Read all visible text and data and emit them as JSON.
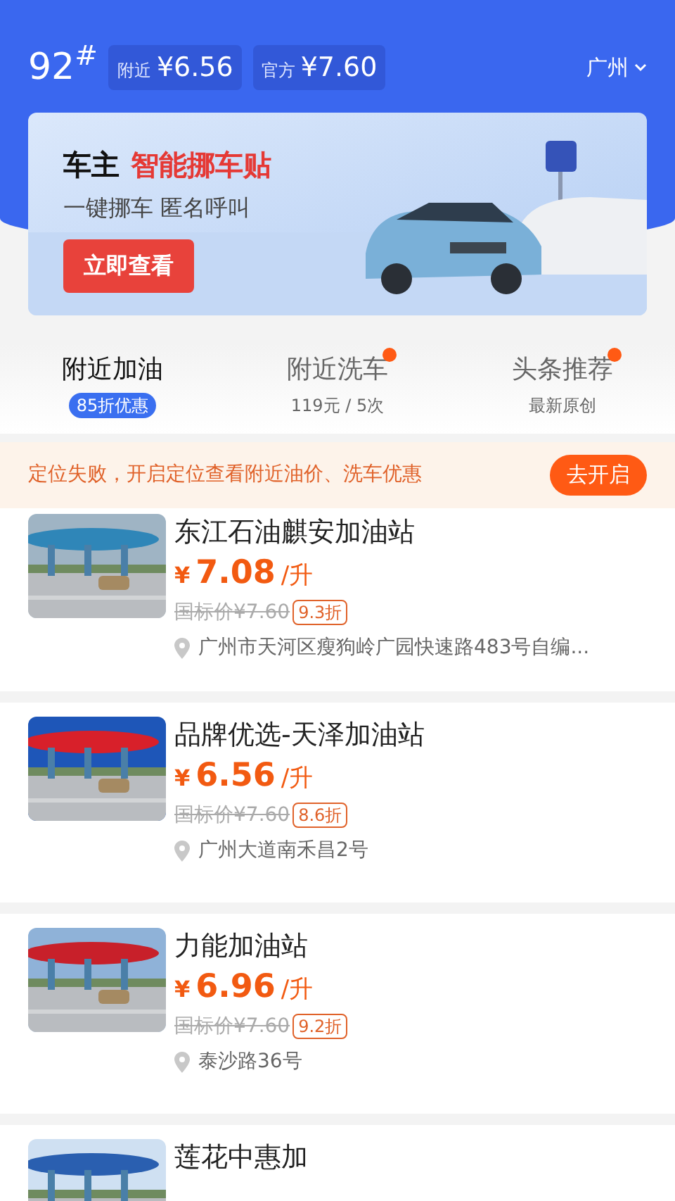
{
  "header": {
    "fuel": "92$^{#}$",
    "prices": [
      {
        "label": "附近",
        "value": "¥6.56"
      },
      {
        "label": "官方",
        "value": "¥7.60"
      }
    ],
    "city": "广州"
  },
  "banner": {
    "title": "车主",
    "highlight": "智能挪车贴",
    "subtitle": "一键挪车 匿名呼叫",
    "button": "立即查看"
  },
  "tabs": [
    {
      "label": "附近加油",
      "sub": "85折优惠",
      "selected": true,
      "dot": false
    },
    {
      "label": "附近洗车",
      "sub": "119元 / 5次",
      "selected": false,
      "dot": true
    },
    {
      "label": "头条推荐",
      "sub": "最新原创",
      "selected": false,
      "dot": true
    }
  ],
  "notice": {
    "text": "定位失败，开启定位查看附近油价、洗车优惠",
    "button": "去开启"
  },
  "stations": [
    {
      "name": "东江石油麒安加油站",
      "currency": "¥",
      "price": "7.08",
      "unit": "/升",
      "original": "国标价¥7.60",
      "discount": "9.3折",
      "address": "广州市天河区瘦狗岭广园快速路483号自编..."
    },
    {
      "name": "品牌优选-天泽加油站",
      "currency": "¥",
      "price": "6.56",
      "unit": "/升",
      "original": "国标价¥7.60",
      "discount": "8.6折",
      "address": "广州大道南禾昌2号"
    },
    {
      "name": "力能加油站",
      "currency": "¥",
      "price": "6.96",
      "unit": "/升",
      "original": "国标价¥7.60",
      "discount": "9.2折",
      "address": "泰沙路36号"
    },
    {
      "name": "莲花中惠加"
    }
  ]
}
